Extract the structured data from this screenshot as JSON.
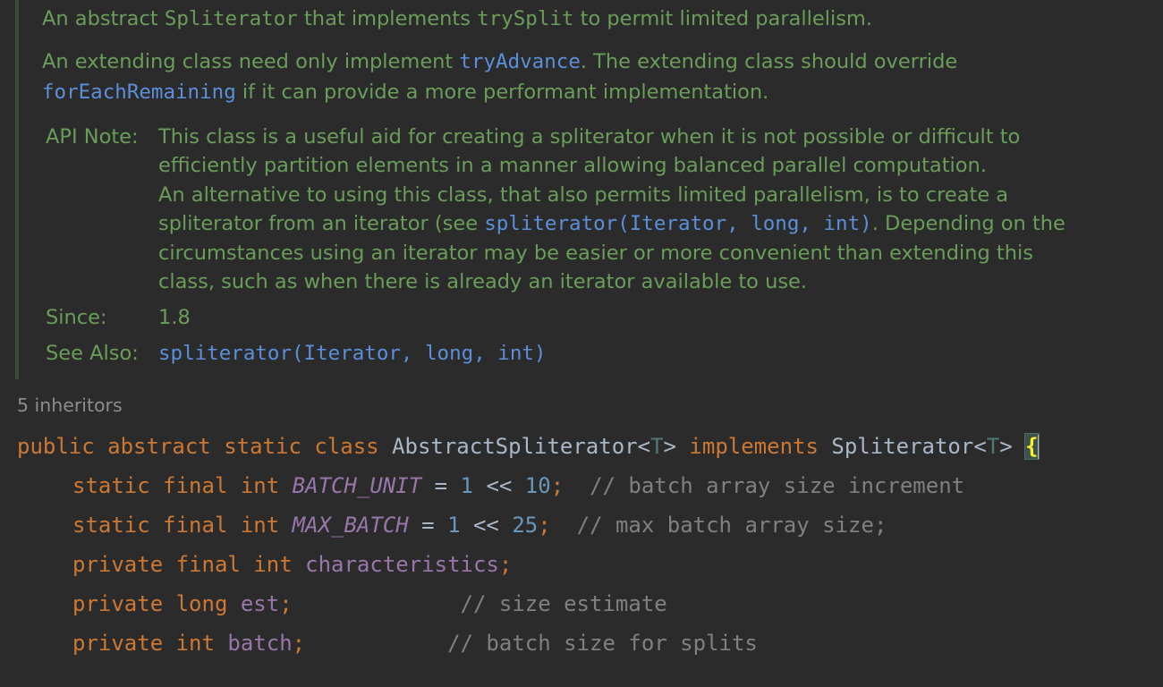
{
  "doc": {
    "line1": {
      "t1": "An abstract ",
      "c1": "Spliterator",
      "t2": " that implements ",
      "c2": "trySplit",
      "t3": " to permit limited parallelism."
    },
    "line2": {
      "t1": "An extending class need only implement ",
      "l1": "tryAdvance",
      "t2": ". The extending class should override"
    },
    "line3": {
      "l1": "forEachRemaining",
      "t1": " if it can provide a more performant implementation."
    },
    "api_note": {
      "label": "API Note:",
      "line1": "This class is a useful aid for creating a spliterator when it is not possible or difficult to",
      "line2": "efficiently partition elements in a manner allowing balanced parallel computation.",
      "line3": "An alternative to using this class, that also permits limited parallelism, is to create a",
      "line4_pre": "spliterator from an iterator (see ",
      "line4_link": "spliterator(Iterator, long, int)",
      "line4_post": ". Depending on the",
      "line5": "circumstances using an iterator may be easier or more convenient than extending this",
      "line6": "class, such as when there is already an iterator available to use."
    },
    "since": {
      "label": "Since:",
      "value": "1.8"
    },
    "see_also": {
      "label": "See Also:",
      "link": "spliterator(Iterator, long, int)"
    }
  },
  "inheritors": "5 inheritors",
  "code": {
    "class_decl": {
      "kw1": "public",
      "kw2": "abstract",
      "kw3": "static",
      "kw4": "class",
      "name": "AbstractSpliterator",
      "lt1": "<",
      "tparam1": "T",
      "gt1": ">",
      "kw5": "implements",
      "iface": "Spliterator",
      "lt2": "<",
      "tparam2": "T",
      "gt2": ">",
      "brace": "{"
    },
    "lines": [
      {
        "mods": [
          "static",
          "final",
          "int"
        ],
        "name": "BATCH_UNIT",
        "eq": "=",
        "v1": "1",
        "op": "<<",
        "v2": "10",
        "semi": ";",
        "comment": "// batch array size increment"
      },
      {
        "mods": [
          "static",
          "final",
          "int"
        ],
        "name": "MAX_BATCH",
        "eq": "=",
        "v1": "1",
        "op": "<<",
        "v2": "25",
        "semi": ";",
        "comment": "// max batch array size;"
      },
      {
        "mods": [
          "private",
          "final",
          "int"
        ],
        "name": "characteristics",
        "semi": ";"
      },
      {
        "mods": [
          "private",
          "long"
        ],
        "name": "est",
        "semi": ";",
        "comment": "// size estimate"
      },
      {
        "mods": [
          "private",
          "int"
        ],
        "name": "batch",
        "semi": ";",
        "comment": "// batch size for splits"
      }
    ]
  },
  "colors": {
    "background": "#2b2b2b",
    "doc_text": "#6a9d5a",
    "doc_link": "#5b8fd9",
    "keyword": "#cc7832",
    "field": "#9876aa",
    "number": "#6897bb",
    "comment": "#808080",
    "type_param": "#507874",
    "brace_highlight": "#ffef28"
  }
}
